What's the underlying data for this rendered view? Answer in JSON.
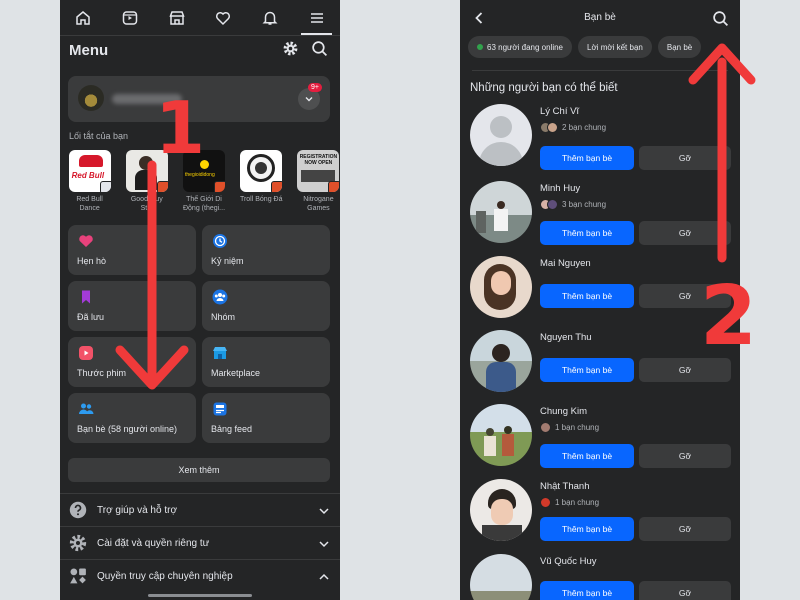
{
  "left": {
    "title": "Menu",
    "badge": "9+",
    "shortcuts_title": "Lối tắt của bạn",
    "shortcuts": [
      {
        "label": "Red Bull Dance",
        "img_text": "Red Bull"
      },
      {
        "label": "Good Guy St..."
      },
      {
        "label": "Thế Giới Di Động (thegi...",
        "img_text": "thegioididong"
      },
      {
        "label": "Troll Bóng Đá"
      },
      {
        "label": "Nitrogane Games",
        "img_text": "REGISTRATION NOW OPEN"
      }
    ],
    "tiles": [
      {
        "label": "Hẹn hò",
        "icon": "heart-icon"
      },
      {
        "label": "Kỷ niệm",
        "icon": "clock-memories-icon"
      },
      {
        "label": "Đã lưu",
        "icon": "bookmark-icon"
      },
      {
        "label": "Nhóm",
        "icon": "groups-icon"
      },
      {
        "label": "Thước phim",
        "icon": "reels-icon"
      },
      {
        "label": "Marketplace",
        "icon": "marketplace-icon"
      },
      {
        "label": "Bạn bè (58 người online)",
        "icon": "friends-icon"
      },
      {
        "label": "Bảng feed",
        "icon": "feeds-icon"
      }
    ],
    "see_more": "Xem thêm",
    "rows": [
      {
        "label": "Trợ giúp và hỗ trợ",
        "icon": "help-icon"
      },
      {
        "label": "Cài đặt và quyền riêng tư",
        "icon": "gear-icon"
      },
      {
        "label": "Quyền truy cập chuyên nghiệp",
        "icon": "shapes-icon"
      }
    ]
  },
  "right": {
    "title": "Bạn bè",
    "chips": [
      "63 người đang online",
      "Lời mời kết bạn",
      "Bạn bè"
    ],
    "pymk_title": "Những người bạn có thể biết",
    "add_label": "Thêm bạn bè",
    "remove_label": "Gỡ",
    "people": [
      {
        "name": "Lý Chí Vĩ",
        "mutual": "2 bạn chung"
      },
      {
        "name": "Minh Huy",
        "mutual": "3 bạn chung"
      },
      {
        "name": "Mai Nguyen",
        "mutual": ""
      },
      {
        "name": "Nguyen Thu",
        "mutual": ""
      },
      {
        "name": "Chung Kim",
        "mutual": "1 bạn chung"
      },
      {
        "name": "Nhật Thanh",
        "mutual": "1 bạn chung"
      },
      {
        "name": "Vũ Quốc Huy",
        "mutual": ""
      }
    ]
  },
  "annotations": {
    "step1": "1",
    "step2": "2"
  },
  "colors": {
    "accent": "#0866ff",
    "annotation": "#f03a3a",
    "panel": "#242526",
    "card": "#3a3b3c"
  }
}
